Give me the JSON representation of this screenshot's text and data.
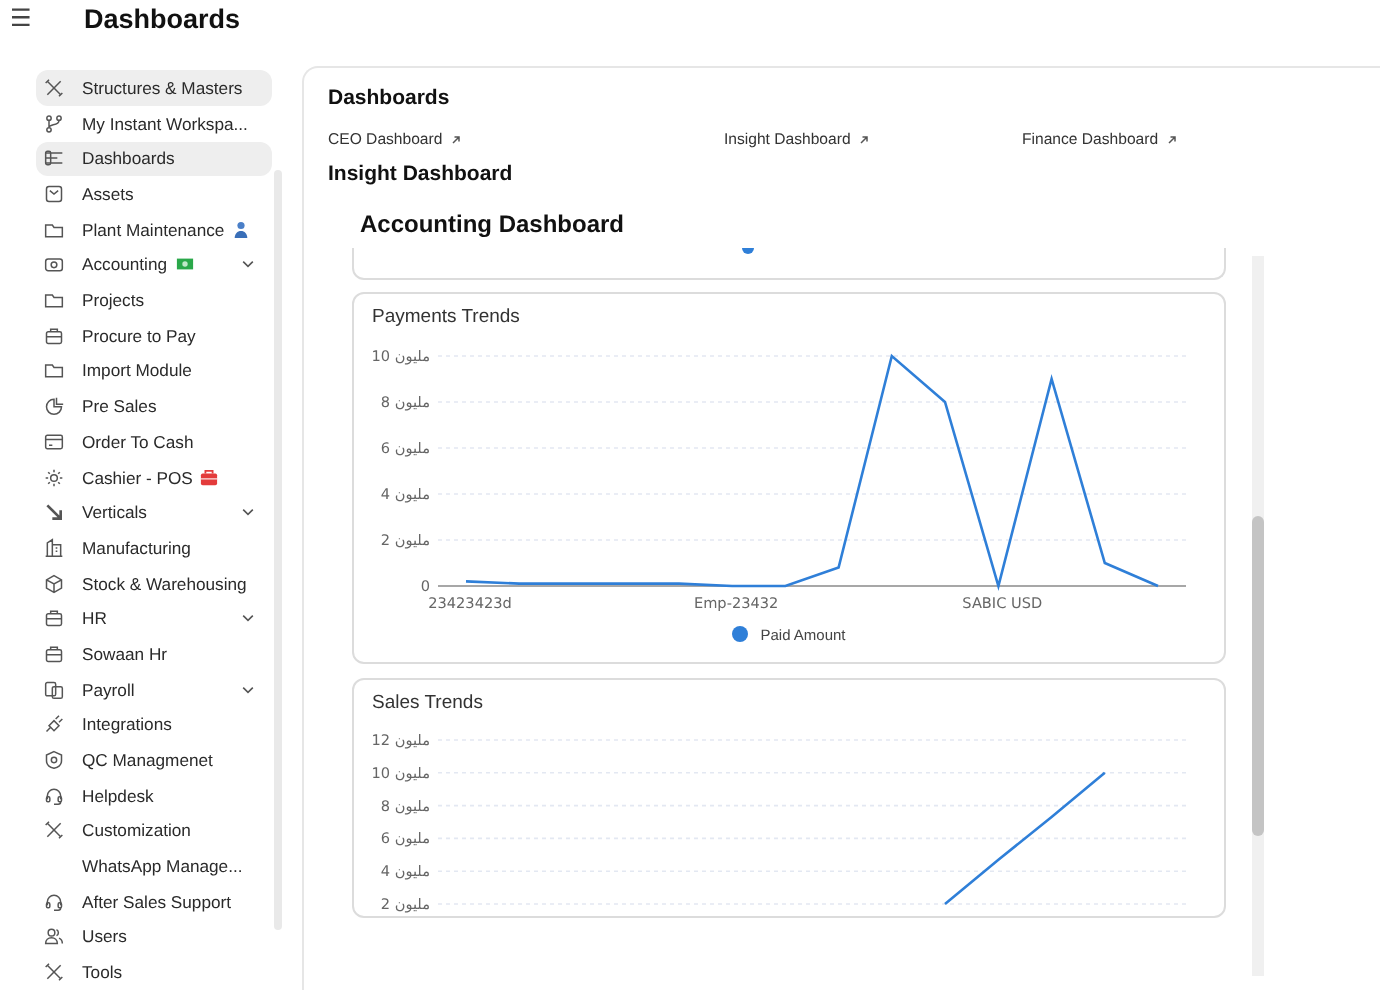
{
  "header": {
    "menu_glyph": "☰",
    "title": "Dashboards"
  },
  "sidebar": {
    "items": [
      {
        "label": "Structures & Masters",
        "selected": true
      },
      {
        "label": "My Instant Workspa...",
        "selected": false
      },
      {
        "label": "Dashboards",
        "selected": true
      },
      {
        "label": "Assets",
        "selected": false
      },
      {
        "label": "Plant Maintenance",
        "selected": false
      },
      {
        "label": "Accounting",
        "selected": false,
        "expanded": false
      },
      {
        "label": "Projects",
        "selected": false
      },
      {
        "label": "Procure to Pay",
        "selected": false
      },
      {
        "label": "Import Module",
        "selected": false
      },
      {
        "label": "Pre Sales",
        "selected": false
      },
      {
        "label": "Order To Cash",
        "selected": false
      },
      {
        "label": "Cashier - POS",
        "selected": false
      },
      {
        "label": "Verticals",
        "selected": false,
        "expanded": false
      },
      {
        "label": "Manufacturing",
        "selected": false
      },
      {
        "label": "Stock & Warehousing",
        "selected": false
      },
      {
        "label": "HR",
        "selected": false,
        "expanded": false
      },
      {
        "label": "Sowaan Hr",
        "selected": false
      },
      {
        "label": "Payroll",
        "selected": false,
        "expanded": false
      },
      {
        "label": "Integrations",
        "selected": false
      },
      {
        "label": "QC Managmenet",
        "selected": false
      },
      {
        "label": "Helpdesk",
        "selected": false
      },
      {
        "label": "Customization",
        "selected": false
      },
      {
        "label": "WhatsApp Manage...",
        "selected": false
      },
      {
        "label": "After Sales Support",
        "selected": false
      },
      {
        "label": "Users",
        "selected": false
      },
      {
        "label": "Tools",
        "selected": false
      }
    ]
  },
  "main": {
    "heading": "Dashboards",
    "links": [
      "CEO Dashboard",
      "Insight Dashboard",
      "Finance Dashboard"
    ],
    "section_heading": "Insight Dashboard",
    "embedded": {
      "title": "Accounting Dashboard",
      "cards": [
        {
          "chart_data": {
            "type": "line",
            "title": "Payments Trends",
            "grid": true,
            "categories": [
              "23423423d",
              null,
              null,
              null,
              null,
              "Emp-23432",
              null,
              null,
              null,
              null,
              "SABIC USD",
              null,
              null,
              null
            ],
            "ylim": [
              0,
              10
            ],
            "yticks": [
              {
                "value": 0,
                "label": "0"
              },
              {
                "value": 2,
                "label": "2 مليون"
              },
              {
                "value": 4,
                "label": "4 مليون"
              },
              {
                "value": 6,
                "label": "6 مليون"
              },
              {
                "value": 8,
                "label": "8 مليون"
              },
              {
                "value": 10,
                "label": "10 مليون"
              }
            ],
            "series": [
              {
                "name": "Paid Amount",
                "color": "#2f7fd8",
                "values": [
                  0.2,
                  0.1,
                  0.1,
                  0.1,
                  0.1,
                  0,
                  0,
                  0.8,
                  10,
                  8,
                  0,
                  9,
                  1,
                  0
                ]
              }
            ]
          }
        },
        {
          "chart_data": {
            "type": "line",
            "title": "Sales Trends",
            "grid": true,
            "categories": [
              null,
              null,
              null,
              null,
              null,
              null,
              null,
              null,
              null,
              null,
              null,
              null,
              null,
              null
            ],
            "ylim": [
              2,
              12
            ],
            "yticks": [
              {
                "value": 2,
                "label": "2 مليون"
              },
              {
                "value": 4,
                "label": "4 مليون"
              },
              {
                "value": 6,
                "label": "6 مليون"
              },
              {
                "value": 8,
                "label": "8 مليون"
              },
              {
                "value": 10,
                "label": "10 مليون"
              },
              {
                "value": 12,
                "label": "12 مليون"
              }
            ],
            "series": [
              {
                "color": "#2f7fd8",
                "values": [
                  null,
                  null,
                  null,
                  null,
                  null,
                  null,
                  null,
                  null,
                  null,
                  2,
                  4.7,
                  7.3,
                  10,
                  null
                ]
              }
            ]
          }
        }
      ]
    }
  }
}
